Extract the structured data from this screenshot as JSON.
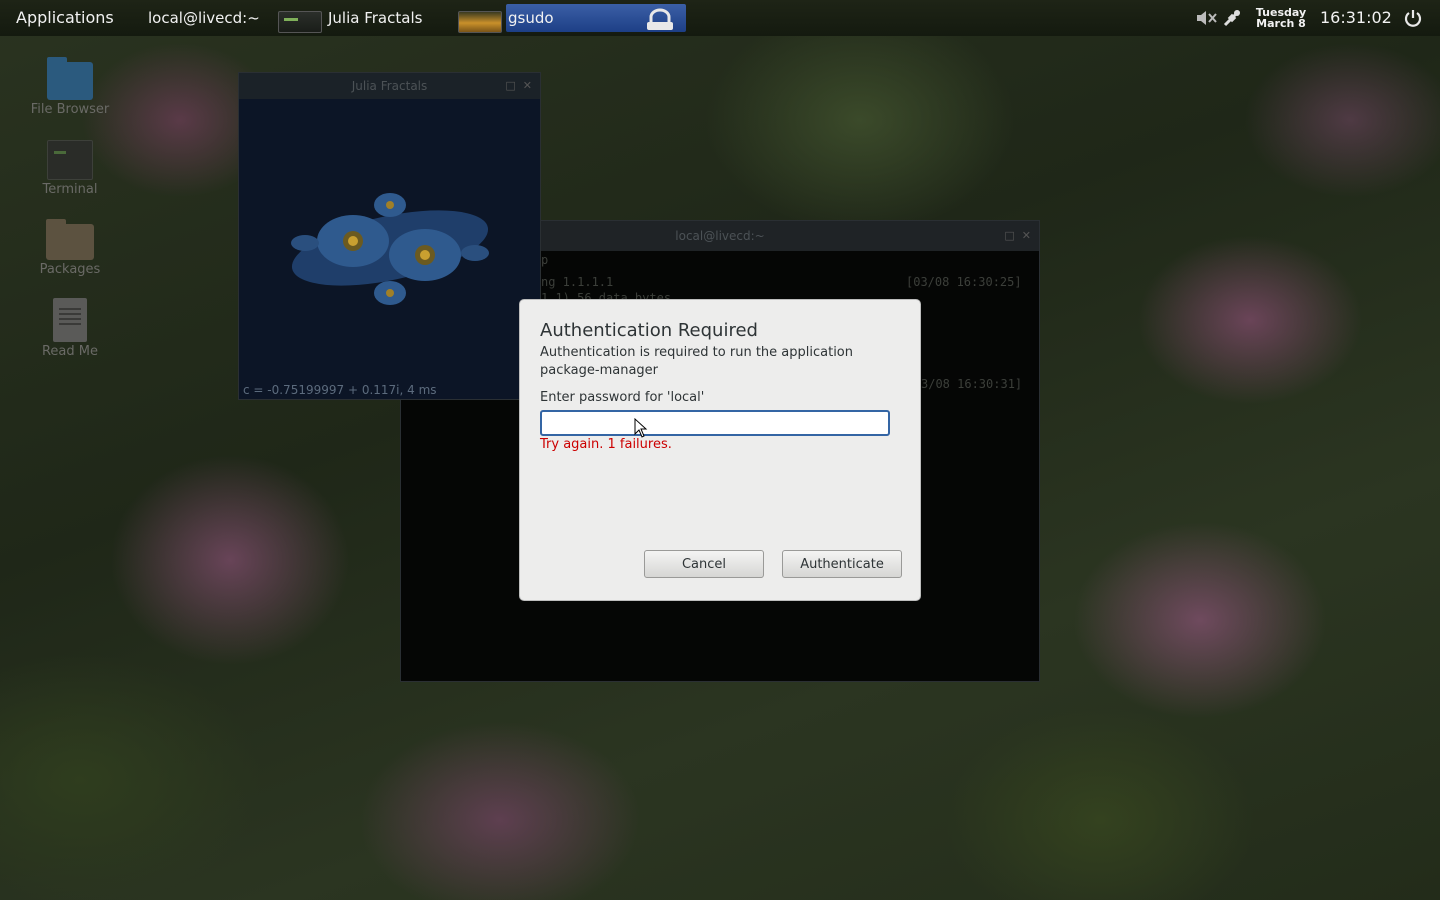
{
  "panel": {
    "applications_label": "Applications",
    "tasks": [
      {
        "label": "local@livecd:~"
      },
      {
        "label": "Julia Fractals"
      },
      {
        "label": "gsudo"
      }
    ],
    "date_day": "Tuesday",
    "date_md": "March 8",
    "clock": "16:31:02"
  },
  "desktop": {
    "icons": [
      {
        "label": "File Browser",
        "icon": "folder-blue-icon"
      },
      {
        "label": "Terminal",
        "icon": "terminal-icon"
      },
      {
        "label": "Packages",
        "icon": "folder-icon"
      },
      {
        "label": "Read Me",
        "icon": "document-icon"
      }
    ]
  },
  "julia_window": {
    "title": "Julia Fractals",
    "status": "c = -0.75199997 + 0.117i, 4 ms"
  },
  "terminal_window": {
    "title": "local@livecd:~",
    "lines": [
      {
        "text": "p"
      },
      {
        "text": "ng 1.1.1.1"
      },
      {
        "text": "1.1) 56 data bytes"
      }
    ],
    "timestamps": [
      "[03/08 16:30:25]",
      "3/08 16:30:31]"
    ]
  },
  "dialog": {
    "title": "Authentication Required",
    "message": "Authentication is required to run the application package-manager",
    "prompt": "Enter password for 'local'",
    "password_value": "",
    "error": "Try again. 1 failures.",
    "cancel_label": "Cancel",
    "authenticate_label": "Authenticate"
  },
  "colors": {
    "accent": "#3465a4",
    "error": "#cc0000",
    "active_task": "#1d3f86"
  }
}
